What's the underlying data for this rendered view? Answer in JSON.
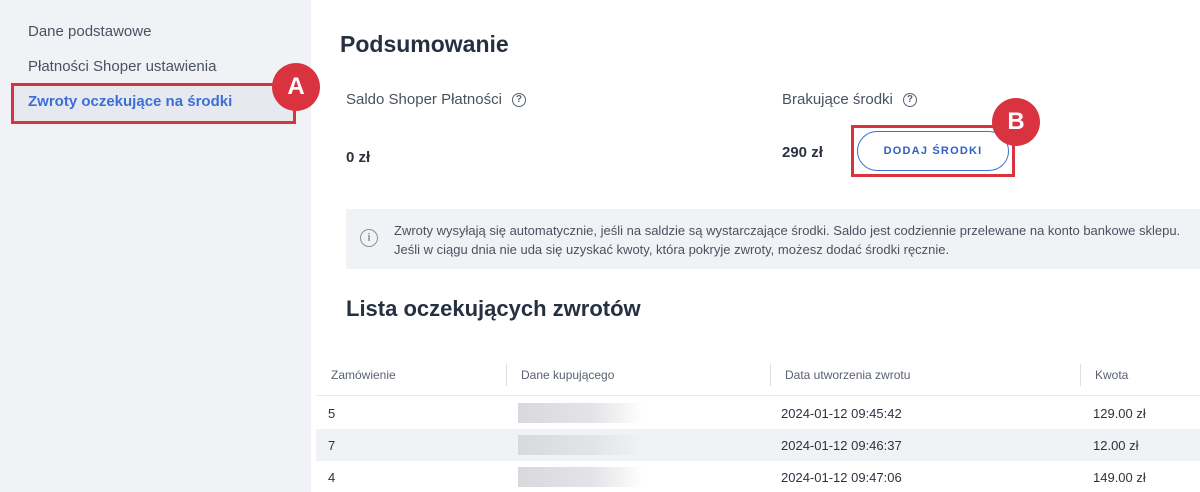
{
  "sidebar": {
    "items": [
      {
        "label": "Dane podstawowe"
      },
      {
        "label": "Płatności Shoper ustawienia"
      },
      {
        "label": "Zwroty oczekujące na środki"
      }
    ]
  },
  "annotations": {
    "a": "A",
    "b": "B"
  },
  "summary": {
    "title": "Podsumowanie",
    "saldo_label": "Saldo Shoper Płatności",
    "saldo_value": "0 zł",
    "missing_label": "Brakujące środki",
    "missing_value": "290 zł",
    "add_button": "DODAJ ŚRODKI",
    "help_icon": "?"
  },
  "info": {
    "icon": "i",
    "line1": "Zwroty wysyłają się automatycznie, jeśli na saldzie są wystarczające środki. Saldo jest codziennie przelewane na konto bankowe sklepu.",
    "line2": "Jeśli w ciągu dnia nie uda się uzyskać kwoty, która pokryje zwroty, możesz dodać środki ręcznie."
  },
  "list": {
    "title": "Lista oczekujących zwrotów",
    "columns": [
      "Zamówienie",
      "Dane kupującego",
      "Data utworzenia zwrotu",
      "Kwota"
    ],
    "rows": [
      {
        "order": "5",
        "date": "2024-01-12 09:45:42",
        "amount": "129.00 zł"
      },
      {
        "order": "7",
        "date": "2024-01-12 09:46:37",
        "amount": "12.00 zł"
      },
      {
        "order": "4",
        "date": "2024-01-12 09:47:06",
        "amount": "149.00 zł"
      }
    ]
  },
  "colors": {
    "accent": "#3b6fd6",
    "annotation": "#d9333f",
    "sidebar_bg": "#f1f2f6"
  }
}
